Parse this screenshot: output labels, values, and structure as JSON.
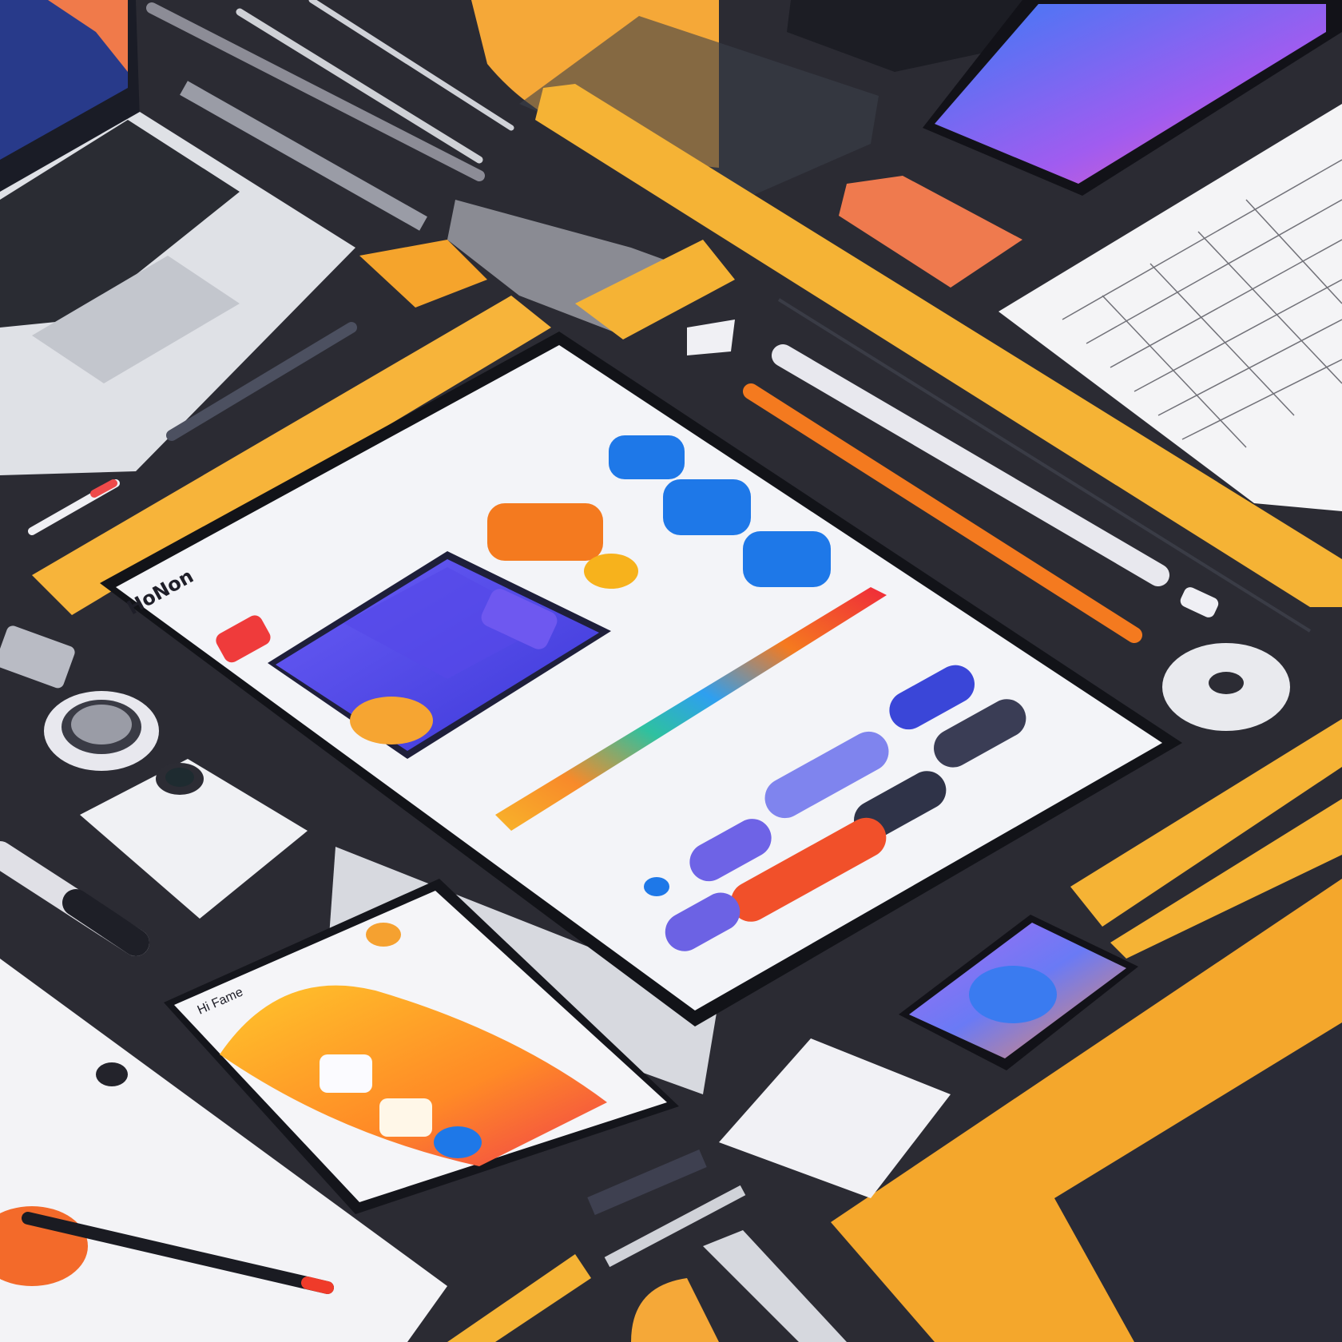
{
  "scene": {
    "description_free": true,
    "background_color": "#2c2c34",
    "accent_colors": {
      "ruler_yellow": "#f5b335",
      "orange": "#f47a1f",
      "blue": "#1e78e8",
      "violet": "#5b4ff0",
      "red": "#ef3b3b",
      "screen_white": "#f3f4f8"
    }
  },
  "tablet": {
    "brand_text": "HoNon",
    "widgets": [
      {
        "name": "orange-pill",
        "color": "#f47a1f"
      },
      {
        "name": "blue-pill-1",
        "color": "#1e78e8"
      },
      {
        "name": "blue-pill-2",
        "color": "#1e78e8"
      },
      {
        "name": "blue-pill-3",
        "color": "#1e78e8"
      },
      {
        "name": "yellow-dot",
        "color": "#f7b21c"
      }
    ],
    "bottom_pills": [
      {
        "name": "pill-violet-1",
        "color": "#3a46d8"
      },
      {
        "name": "pill-dark-1",
        "color": "#3a3d55"
      },
      {
        "name": "pill-lilac-1",
        "color": "#7f84ee"
      },
      {
        "name": "pill-dark-2",
        "color": "#2f3348"
      },
      {
        "name": "pill-violet-2",
        "color": "#6e63e6"
      },
      {
        "name": "pill-orange-red",
        "color": "#f1502a"
      },
      {
        "name": "pill-violet-3",
        "color": "#6c62e4"
      }
    ]
  },
  "phone_left": {
    "header_text": "Hi Fame"
  }
}
